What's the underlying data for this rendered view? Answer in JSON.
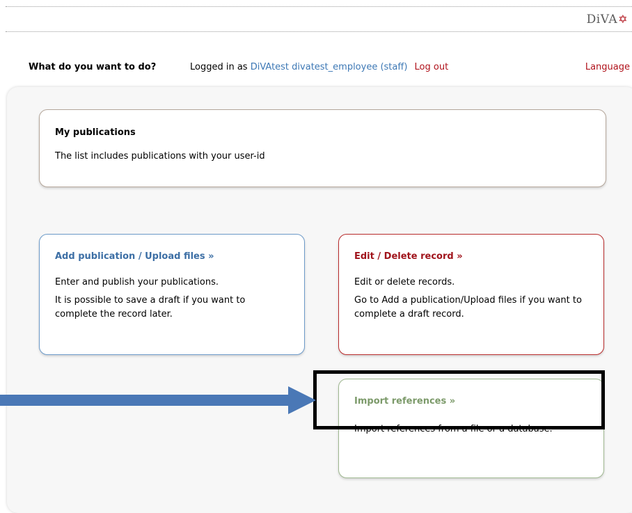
{
  "logo": {
    "text": "DiVA",
    "star": "✡"
  },
  "topbar": {
    "question": "What do you want to do?",
    "logged_in_prefix": "Logged in as",
    "user": "DiVAtest divatest_employee (staff)",
    "logout": "Log out",
    "language": "Language"
  },
  "cards": {
    "my_publications": {
      "title": "My publications",
      "text": "The list includes publications with your user-id"
    },
    "add": {
      "title": "Add publication / Upload files »",
      "text1": "Enter and publish your publications.",
      "text2": "It is possible to save a draft if you want to complete the record later."
    },
    "edit": {
      "title": "Edit / Delete record »",
      "text1": "Edit or delete records.",
      "text2": "Go to Add a publication/Upload files if you want to complete a draft record."
    },
    "import": {
      "title": "Import references »",
      "text1": "Import references from a file or a database."
    }
  },
  "colors": {
    "link_blue": "#3d78b5",
    "logout_red": "#b0121b",
    "add_border": "#6c9ac9",
    "edit_border": "#b82b2b",
    "import_border": "#9fb890",
    "arrow": "#4a78b6",
    "highlight": "#000000"
  },
  "annotation": {
    "arrow_icon": "right-arrow-icon",
    "box": "highlight-box"
  }
}
